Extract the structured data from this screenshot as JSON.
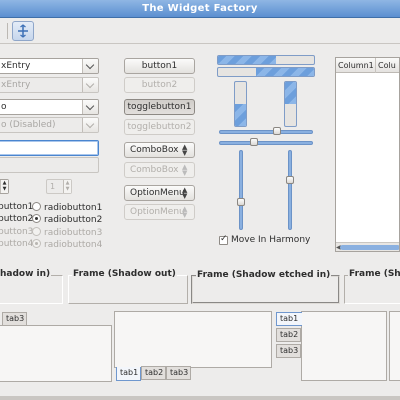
{
  "window": {
    "title": "The Widget Factory"
  },
  "entries": {
    "entry1": "xEntry",
    "entry2": "xEntry",
    "combo_entry1": "o",
    "combo_entry2": "o (Disabled)",
    "entry_focus": "",
    "entry_disabled": ""
  },
  "spins": {
    "spin1": "",
    "spin2": "1"
  },
  "radios": [
    {
      "label": "button1",
      "state": "on"
    },
    {
      "label": "button2",
      "state": "off"
    },
    {
      "label": "button3",
      "state": "off-disabled"
    },
    {
      "label": "button4",
      "state": "off-disabled"
    }
  ],
  "radios_col2": [
    {
      "label": "radiobutton1",
      "state": "off"
    },
    {
      "label": "radiobutton2",
      "state": "on"
    },
    {
      "label": "radiobutton3",
      "state": "off-disabled"
    },
    {
      "label": "radiobutton4",
      "state": "on-disabled"
    }
  ],
  "buttons": {
    "button1": "button1",
    "button2": "button2",
    "togglebutton1": "togglebutton1",
    "togglebutton2": "togglebutton2",
    "combobox1": "ComboBox",
    "combobox2": "ComboBox",
    "optionmenu1": "OptionMenu",
    "optionmenu2": "OptionMenu"
  },
  "progress": {
    "horizontal1": 0.6,
    "horizontal2": 0.4,
    "vertical1": 0.5,
    "vertical2": 0.5
  },
  "check_move_harmony": {
    "label": "Move In Harmony",
    "checked": true
  },
  "treeview": {
    "columns": [
      "Column1",
      "Colu"
    ]
  },
  "frames": [
    {
      "label": "hadow in)"
    },
    {
      "label": "Frame (Shadow out)"
    },
    {
      "label": "Frame (Shadow etched in)"
    },
    {
      "label": "Frame (Sha"
    }
  ],
  "notebooks": {
    "nb1_tabs": [
      "tab3"
    ],
    "nb2_tabs": [
      "tab1",
      "tab2",
      "tab3"
    ],
    "nb3_tabs": [
      "tab1",
      "tab2",
      "tab3"
    ]
  }
}
